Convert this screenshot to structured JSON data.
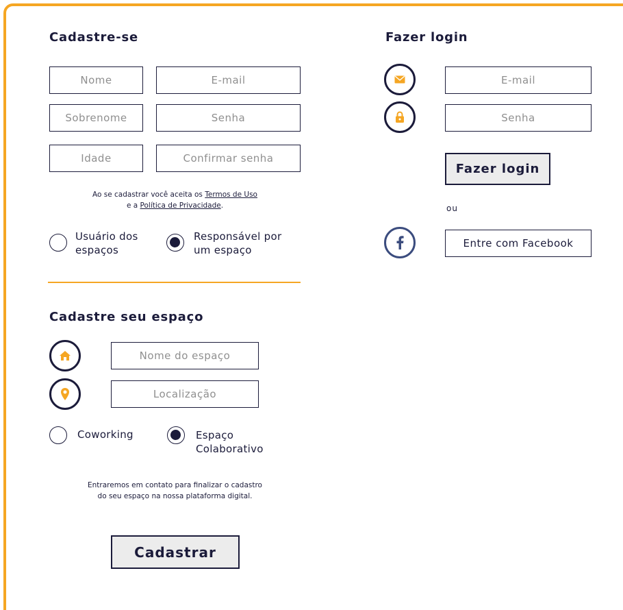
{
  "signup": {
    "title": "Cadastre-se",
    "fields": {
      "nome": "Nome",
      "email": "E-mail",
      "sobrenome": "Sobrenome",
      "senha": "Senha",
      "idade": "Idade",
      "confirmar": "Confirmar senha"
    },
    "terms": {
      "prefix": "Ao se cadastrar você aceita os ",
      "terms_link": "Termos de Uso",
      "mid": "e a ",
      "privacy_link": "Política de Privacidade",
      "suffix": "."
    },
    "roles": [
      {
        "line1": "Usuário dos",
        "line2": "espaços",
        "selected": false
      },
      {
        "line1": "Responsável por",
        "line2": "um espaço",
        "selected": true
      }
    ]
  },
  "space": {
    "title": "Cadastre seu espaço",
    "fields": {
      "nome": "Nome do espaço",
      "local": "Localização"
    },
    "types": [
      {
        "line1": "Coworking",
        "line2": "",
        "selected": false
      },
      {
        "line1": "Espaço",
        "line2": "Colaborativo",
        "selected": true
      }
    ],
    "note_line1": "Entraremos em contato para finalizar o cadastro",
    "note_line2": "do seu espaço na nossa plataforma digital.",
    "submit": "Cadastrar"
  },
  "login": {
    "title": "Fazer login",
    "fields": {
      "email": "E-mail",
      "senha": "Senha"
    },
    "submit": "Fazer login",
    "or": "ou",
    "facebook": "Entre com Facebook"
  },
  "colors": {
    "accent": "#f5a623",
    "navy": "#1b1b3a",
    "facebook": "#3b4c7e",
    "button_bg": "#ececec"
  },
  "icons": [
    "mail-icon",
    "lock-icon",
    "home-icon",
    "location-pin-icon",
    "facebook-icon"
  ]
}
